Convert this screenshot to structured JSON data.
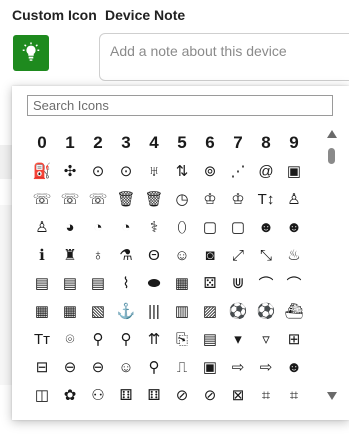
{
  "header": {
    "custom_icon_label": "Custom Icon",
    "device_note_label": "Device Note",
    "note_placeholder": "Add a note about this device"
  },
  "icon_picker": {
    "search_placeholder": "Search Icons",
    "rows": [
      [
        {
          "g": "0",
          "name": "digit-0"
        },
        {
          "g": "1",
          "name": "digit-1"
        },
        {
          "g": "2",
          "name": "digit-2"
        },
        {
          "g": "3",
          "name": "digit-3"
        },
        {
          "g": "4",
          "name": "digit-4"
        },
        {
          "g": "5",
          "name": "digit-5"
        },
        {
          "g": "6",
          "name": "digit-6"
        },
        {
          "g": "7",
          "name": "digit-7"
        },
        {
          "g": "8",
          "name": "digit-8"
        },
        {
          "g": "9",
          "name": "digit-9"
        }
      ],
      [
        {
          "g": "⛽",
          "name": "format-color-fill-icon"
        },
        {
          "g": "✣",
          "name": "compress-arrows-icon"
        },
        {
          "g": "⊙",
          "name": "circle-chevron-icon"
        },
        {
          "g": "⊙",
          "name": "circle-chevron-alt-icon"
        },
        {
          "g": "♅",
          "name": "teapot-icon"
        },
        {
          "g": "⇅",
          "name": "sort-list-icon"
        },
        {
          "g": "⊚",
          "name": "link-circle-icon"
        },
        {
          "g": "⋰",
          "name": "dots-curve-icon"
        },
        {
          "g": "@",
          "name": "at-icon"
        },
        {
          "g": "▣",
          "name": "dashboard-icon"
        }
      ],
      [
        {
          "g": "☏",
          "name": "phone-callback-icon"
        },
        {
          "g": "☏",
          "name": "phone-missed-icon"
        },
        {
          "g": "☏",
          "name": "phone-forwarded-icon"
        },
        {
          "g": "🗑",
          "name": "trash-icon"
        },
        {
          "g": "🗑",
          "name": "trash-outline-icon"
        },
        {
          "g": "◷",
          "name": "clock-icon"
        },
        {
          "g": "♔",
          "name": "helmet-icon"
        },
        {
          "g": "♔",
          "name": "helmet-outline-icon"
        },
        {
          "g": "T↕",
          "name": "text-height-icon"
        },
        {
          "g": "♙",
          "name": "person-remove-icon"
        }
      ],
      [
        {
          "g": "♙",
          "name": "person-remove-outline-icon"
        },
        {
          "g": "◕",
          "name": "gauge-icon"
        },
        {
          "g": "◔",
          "name": "timelapse-icon"
        },
        {
          "g": "◔",
          "name": "timelapse-outline-icon"
        },
        {
          "g": "⚕",
          "name": "stethoscope-icon"
        },
        {
          "g": "⬯",
          "name": "capsule-icon"
        },
        {
          "g": "▢",
          "name": "chat-bubble-icon"
        },
        {
          "g": "▢",
          "name": "chat-bubble-outline-icon"
        },
        {
          "g": "☻",
          "name": "face-icon"
        },
        {
          "g": "☻",
          "name": "face-outline-icon"
        }
      ],
      [
        {
          "g": "ℹ",
          "name": "info-icon"
        },
        {
          "g": "♜",
          "name": "castle-icon"
        },
        {
          "g": "♁",
          "name": "kettlebell-icon"
        },
        {
          "g": "⚗",
          "name": "mortar-icon"
        },
        {
          "g": "Θ",
          "name": "theta-icon"
        },
        {
          "g": "☺",
          "name": "sentiment-icon"
        },
        {
          "g": "◙",
          "name": "portrait-icon"
        },
        {
          "g": "⤢",
          "name": "expand-diagonal-icon"
        },
        {
          "g": "⤡",
          "name": "collapse-diagonal-icon"
        },
        {
          "g": "♨",
          "name": "campfire-icon"
        }
      ],
      [
        {
          "g": "▤",
          "name": "document-icon"
        },
        {
          "g": "▤",
          "name": "document-alt-icon"
        },
        {
          "g": "▤",
          "name": "document-outline-icon"
        },
        {
          "g": "⌇",
          "name": "pulse-icon"
        },
        {
          "g": "⬬",
          "name": "pill-icon"
        },
        {
          "g": "▦",
          "name": "calculator-icon"
        },
        {
          "g": "⚄",
          "name": "dice-icon"
        },
        {
          "g": "⋓",
          "name": "magnet-icon"
        },
        {
          "g": "⌒",
          "name": "wifi-low-icon"
        },
        {
          "g": "⌒",
          "name": "wifi-low-alt-icon"
        }
      ],
      [
        {
          "g": "▦",
          "name": "calendar-icon"
        },
        {
          "g": "▦",
          "name": "calendar-alt-icon"
        },
        {
          "g": "▧",
          "name": "book-icon"
        },
        {
          "g": "⚓",
          "name": "anchor-icon"
        },
        {
          "g": "|||",
          "name": "barcode-icon"
        },
        {
          "g": "▥",
          "name": "building-icon"
        },
        {
          "g": "▨",
          "name": "apartment-icon"
        },
        {
          "g": "⚽",
          "name": "ball-icon"
        },
        {
          "g": "⚽",
          "name": "ball-outline-icon"
        },
        {
          "g": "⛴",
          "name": "ship-icon"
        }
      ],
      [
        {
          "g": "Tт",
          "name": "text-fields-icon"
        },
        {
          "g": "⌾",
          "name": "hat-icon"
        },
        {
          "g": "⚲",
          "name": "pen-icon"
        },
        {
          "g": "⚲",
          "name": "pen-outline-icon"
        },
        {
          "g": "⇈",
          "name": "vertical-align-top-icon"
        },
        {
          "g": "⎘",
          "name": "note-add-icon"
        },
        {
          "g": "▤",
          "name": "grid-view-icon"
        },
        {
          "g": "▾",
          "name": "caret-down-icon"
        },
        {
          "g": "▿",
          "name": "caret-down-outline-icon"
        },
        {
          "g": "⊞",
          "name": "folder-add-icon"
        }
      ],
      [
        {
          "g": "⊟",
          "name": "folder-remove-icon"
        },
        {
          "g": "⊖",
          "name": "minus-circle-icon"
        },
        {
          "g": "⊖",
          "name": "minus-circle-outline-icon"
        },
        {
          "g": "☺",
          "name": "mood-icon"
        },
        {
          "g": "⚲",
          "name": "key-icon"
        },
        {
          "g": "⎍",
          "name": "door-icon"
        },
        {
          "g": "▣",
          "name": "tablet-icon"
        },
        {
          "g": "⇨",
          "name": "exit-icon"
        },
        {
          "g": "⇨",
          "name": "exit-outline-icon"
        },
        {
          "g": "☻",
          "name": "smile-icon"
        }
      ],
      [
        {
          "g": "◫",
          "name": "storage-icon"
        },
        {
          "g": "✿",
          "name": "flower-icon"
        },
        {
          "g": "⚇",
          "name": "robot-icon"
        },
        {
          "g": "⚅",
          "name": "crosshair-icon"
        },
        {
          "g": "⚅",
          "name": "crosshair-alt-icon"
        },
        {
          "g": "⊘",
          "name": "mic-off-icon"
        },
        {
          "g": "⊘",
          "name": "mic-off-outline-icon"
        },
        {
          "g": "⊠",
          "name": "image-off-icon"
        },
        {
          "g": "⌗",
          "name": "hash-grid-icon"
        },
        {
          "g": "⌗",
          "name": "hash-grid-alt-icon"
        }
      ]
    ]
  }
}
